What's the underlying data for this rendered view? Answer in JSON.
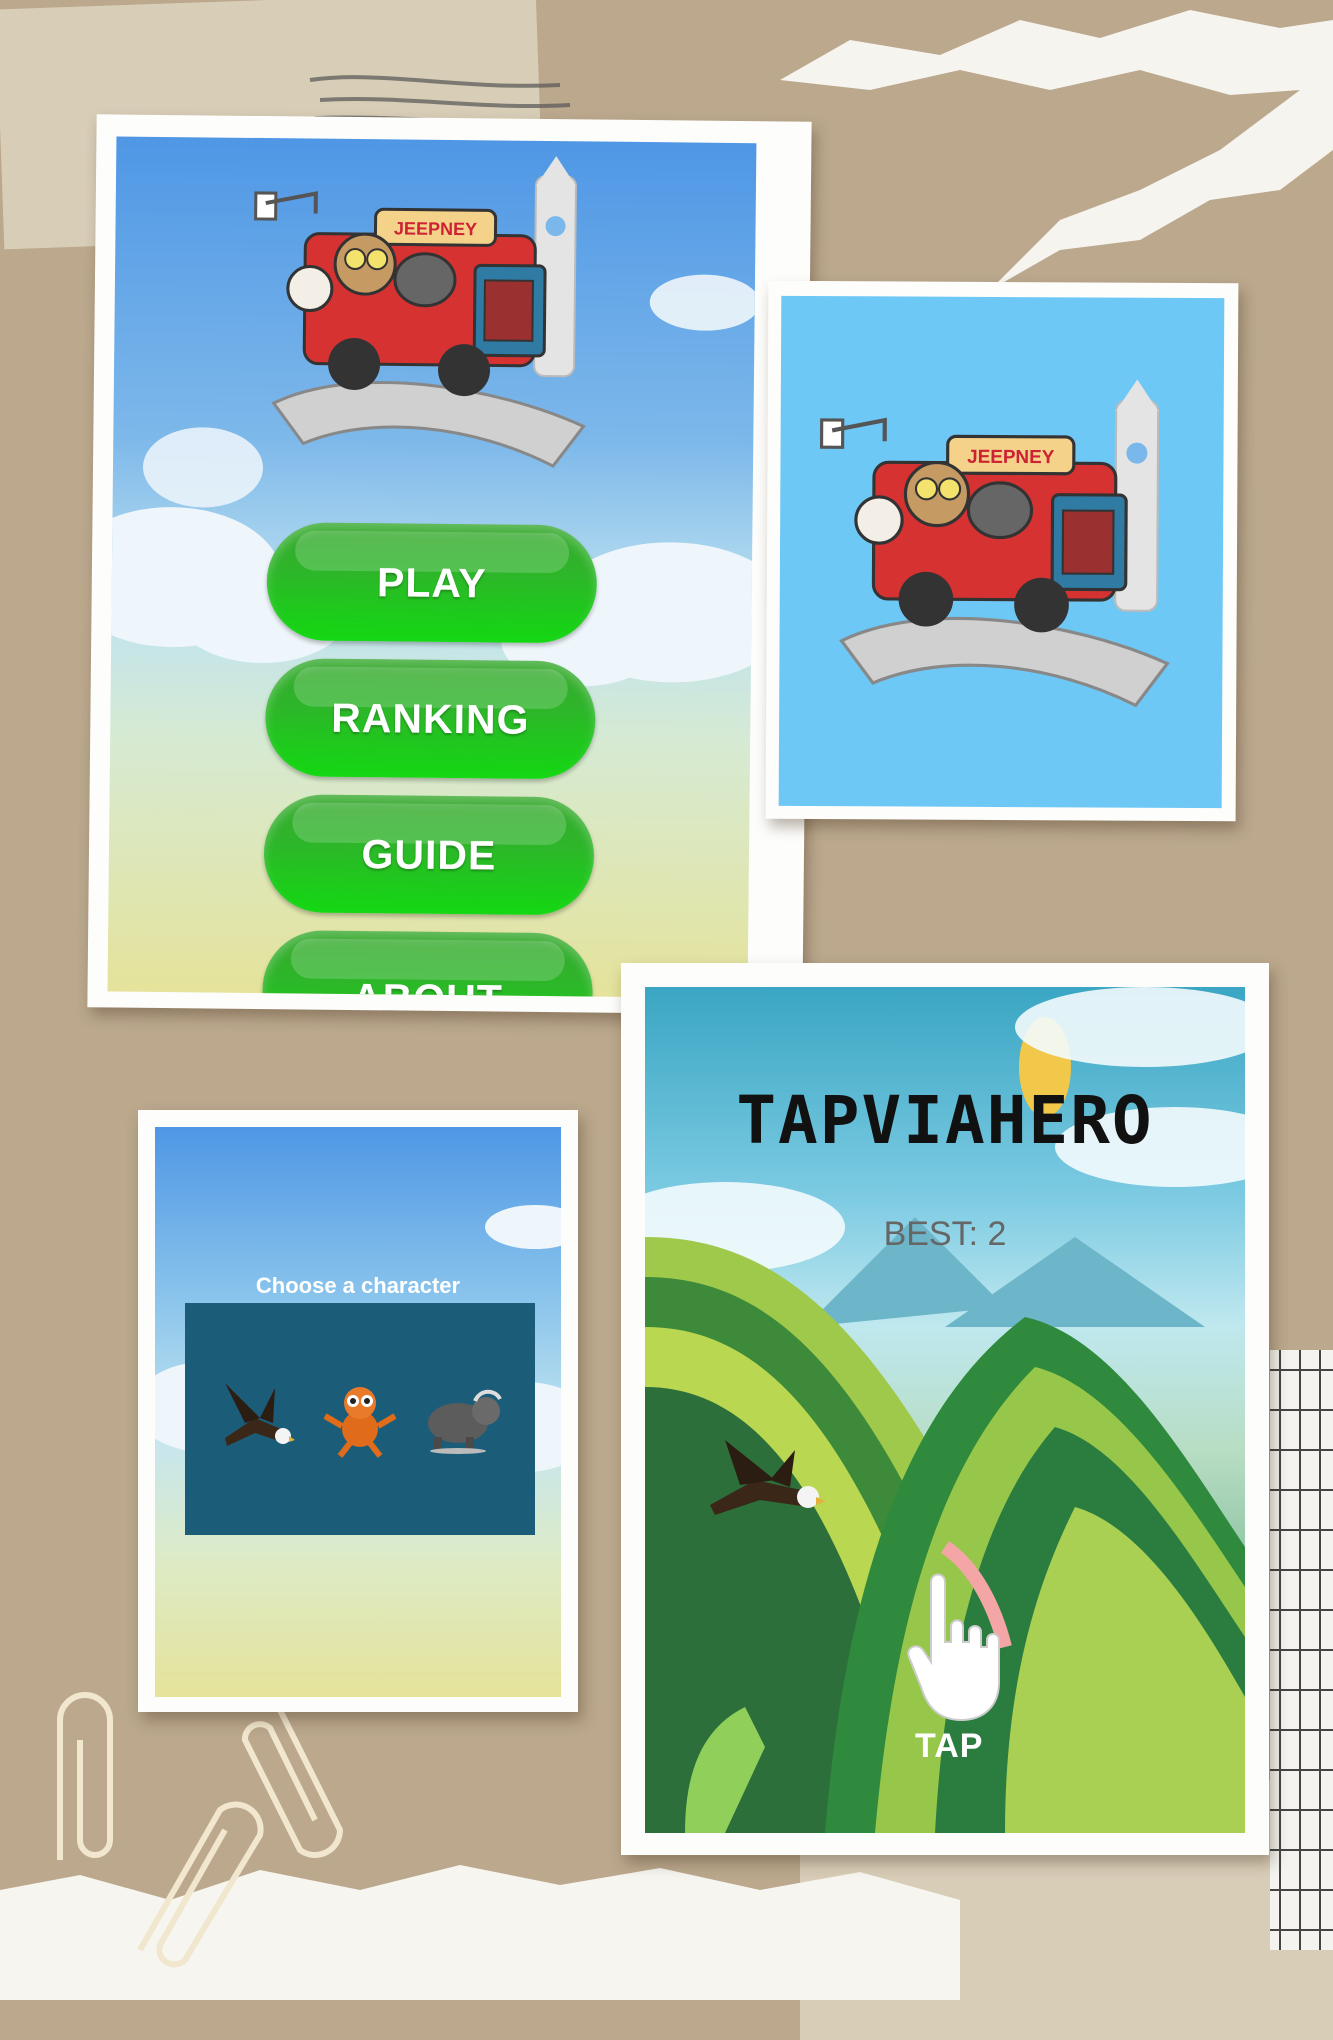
{
  "colors": {
    "background": "#bba88d",
    "button_green": "#15c514",
    "sky_blue": "#62c4f4",
    "character_panel": "#1b5c78"
  },
  "menu_screen": {
    "buttons": [
      {
        "label": "PLAY"
      },
      {
        "label": "RANKING"
      },
      {
        "label": "GUIDE"
      },
      {
        "label": "ABOUT"
      }
    ],
    "logo_sign": "JEEPNEY"
  },
  "splash_screen": {
    "logo_sign": "JEEPNEY"
  },
  "character_screen": {
    "heading": "Choose a character",
    "characters": [
      {
        "icon": "eagle-icon"
      },
      {
        "icon": "tarsier-icon"
      },
      {
        "icon": "carabao-icon"
      }
    ]
  },
  "game_screen": {
    "title": "TAPVIAHERO",
    "best": "BEST: 2",
    "tap_label": "TAP"
  }
}
